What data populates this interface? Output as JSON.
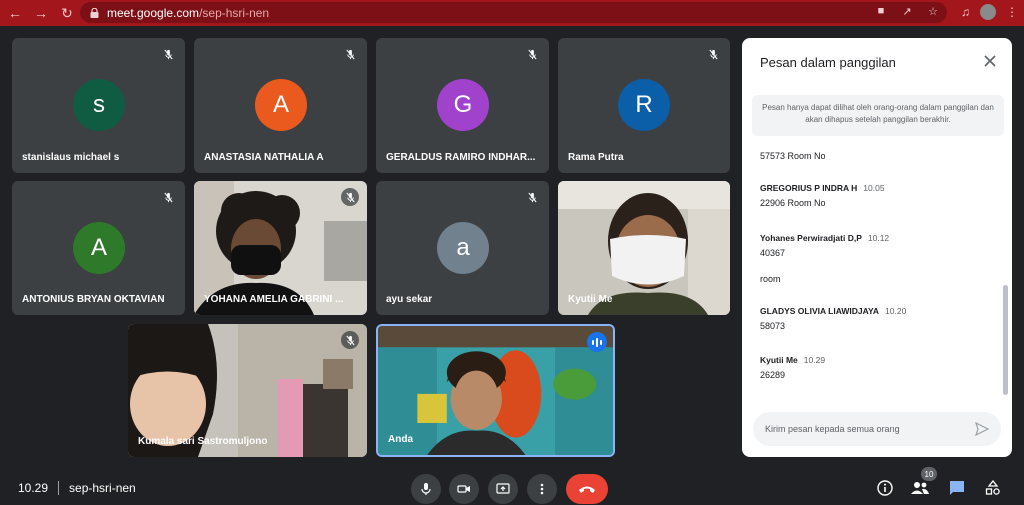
{
  "browser": {
    "url_host": "meet.google.com",
    "url_path": "/sep-hsri-nen"
  },
  "colors": {
    "chrome_red": "#a3161c",
    "tile_bg": "#3c4043",
    "end_call_red": "#ea4335",
    "accent_blue": "#8ab4f8",
    "chat_active_blue": "#8ab4f8"
  },
  "participants": [
    {
      "name": "stanislaus michael s",
      "initial": "s",
      "color": "#0f5c43",
      "muted": true
    },
    {
      "name": "ANASTASIA NATHALIA A",
      "initial": "A",
      "color": "#ea5a1f",
      "muted": true
    },
    {
      "name": "GERALDUS RAMIRO INDHAR...",
      "initial": "G",
      "color": "#a142cc",
      "muted": true
    },
    {
      "name": "Rama Putra",
      "initial": "R",
      "color": "#0b5ea8",
      "muted": true
    },
    {
      "name": "ANTONIUS BRYAN OKTAVIAN",
      "initial": "A",
      "color": "#2e7a2a",
      "muted": true
    },
    {
      "name": "YOHANA AMELIA GABRINI ...",
      "initial": "",
      "color": "",
      "muted": true
    },
    {
      "name": "ayu sekar",
      "initial": "a",
      "color": "#71818d",
      "muted": true
    },
    {
      "name": "Kyutii Me",
      "initial": "",
      "color": "",
      "muted": false
    },
    {
      "name": "Kumala sari Sastromuljono",
      "initial": "",
      "color": "",
      "muted": true
    },
    {
      "name": "Anda",
      "initial": "",
      "color": "",
      "muted": false
    }
  ],
  "chat": {
    "title": "Pesan dalam panggilan",
    "notice": "Pesan hanya dapat dilihat oleh orang-orang dalam panggilan dan akan dihapus setelah panggilan berakhir.",
    "messages": [
      {
        "sender": "",
        "time": "",
        "lines": [
          "57573 Room No"
        ]
      },
      {
        "sender": "GREGORIUS P INDRA H",
        "time": "10.05",
        "lines": [
          "22906 Room No"
        ]
      },
      {
        "sender": "Yohanes Perwiradjati D,P",
        "time": "10.12",
        "lines": [
          "40367",
          "room"
        ]
      },
      {
        "sender": "GLADYS OLIVIA LIAWIDJAYA",
        "time": "10.20",
        "lines": [
          "58073"
        ]
      },
      {
        "sender": "Kyutii Me",
        "time": "10.29",
        "lines": [
          "26289"
        ]
      }
    ],
    "input_placeholder": "Kirim pesan kepada semua orang"
  },
  "bottom_bar": {
    "time": "10.29",
    "meeting_code": "sep-hsri-nen",
    "participant_count": "10"
  }
}
